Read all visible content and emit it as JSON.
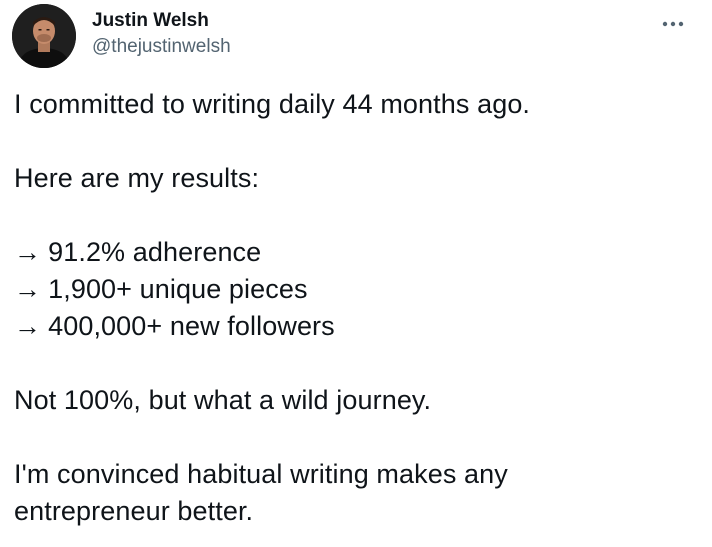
{
  "author": {
    "display_name": "Justin Welsh",
    "handle": "@thejustinwelsh",
    "avatar_icon": "avatar-photo"
  },
  "menu": {
    "icon": "more-horizontal-icon"
  },
  "tweet": {
    "line1": "I committed to writing daily 44 months ago.",
    "line2": "Here are my results:",
    "results": [
      {
        "arrow": "→",
        "text": "91.2% adherence"
      },
      {
        "arrow": "→",
        "text": "1,900+ unique pieces"
      },
      {
        "arrow": "→",
        "text": "400,000+ new followers"
      }
    ],
    "line3": "Not 100%, but what a wild journey.",
    "line4a": "I'm convinced habitual writing makes any",
    "line4b": "entrepreneur better."
  },
  "colors": {
    "text": "#0f1419",
    "secondary": "#536471",
    "background": "#ffffff"
  }
}
